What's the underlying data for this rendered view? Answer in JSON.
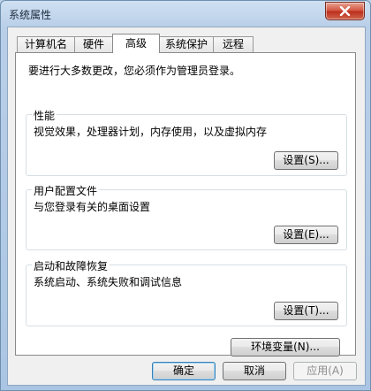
{
  "window": {
    "title": "系统属性"
  },
  "tabs": [
    {
      "label": "计算机名"
    },
    {
      "label": "硬件"
    },
    {
      "label": "高级"
    },
    {
      "label": "系统保护"
    },
    {
      "label": "远程"
    }
  ],
  "panel": {
    "notice": "要进行大多数更改，您必须作为管理员登录。",
    "performance": {
      "title": "性能",
      "desc": "视觉效果，处理器计划，内存使用，以及虚拟内存",
      "button": "设置(S)..."
    },
    "user_profiles": {
      "title": "用户配置文件",
      "desc": "与您登录有关的桌面设置",
      "button": "设置(E)..."
    },
    "startup_recovery": {
      "title": "启动和故障恢复",
      "desc": "系统启动、系统失败和调试信息",
      "button": "设置(T)..."
    },
    "env_button": "环境变量(N)..."
  },
  "footer": {
    "ok": "确定",
    "cancel": "取消",
    "apply": "应用(A)"
  }
}
